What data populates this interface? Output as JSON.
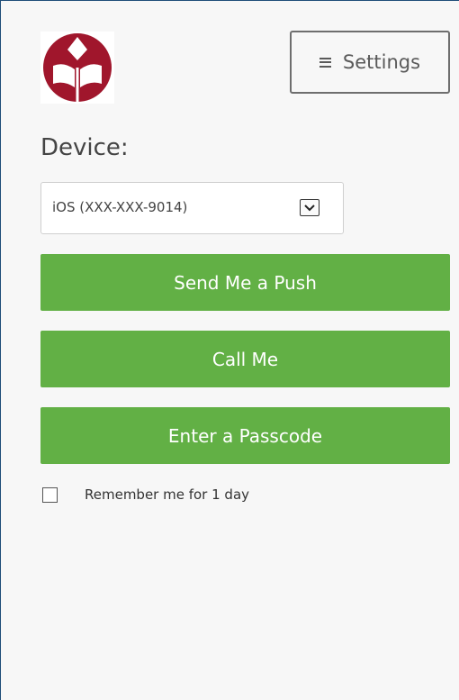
{
  "header": {
    "logo_icon": "university-logo-icon",
    "logo_color": "#a0162c",
    "settings_icon": "hamburger-menu-icon",
    "settings_label": "Settings"
  },
  "device": {
    "label": "Device:",
    "selected": "iOS (XXX-XXX-9014)",
    "dropdown_icon": "chevron-down-icon"
  },
  "actions": {
    "push_label": "Send Me a Push",
    "call_label": "Call Me",
    "passcode_label": "Enter a Passcode",
    "button_color": "#62b045"
  },
  "remember": {
    "label": "Remember me for 1 day",
    "checked": false
  }
}
